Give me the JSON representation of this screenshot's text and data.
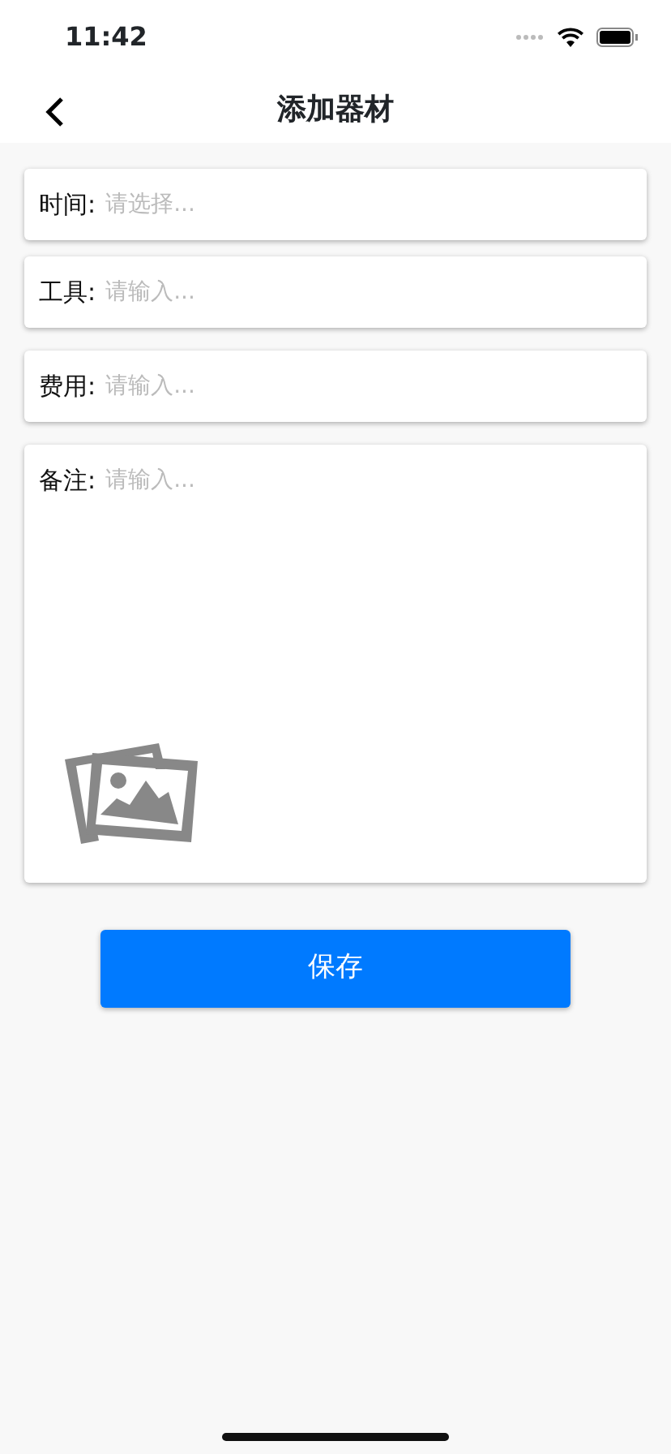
{
  "status_bar": {
    "time": "11:42"
  },
  "nav": {
    "title": "添加器材"
  },
  "fields": [
    {
      "kind": "single",
      "label": "时间:",
      "placeholder": "请选择..."
    },
    {
      "kind": "single",
      "label": "工具:",
      "placeholder": "请输入..."
    },
    {
      "kind": "single",
      "label": "费用:",
      "placeholder": "请输入..."
    },
    {
      "kind": "multiline",
      "label": "备注:",
      "placeholder": "请输入..."
    }
  ],
  "save_button": {
    "label": "保存"
  }
}
